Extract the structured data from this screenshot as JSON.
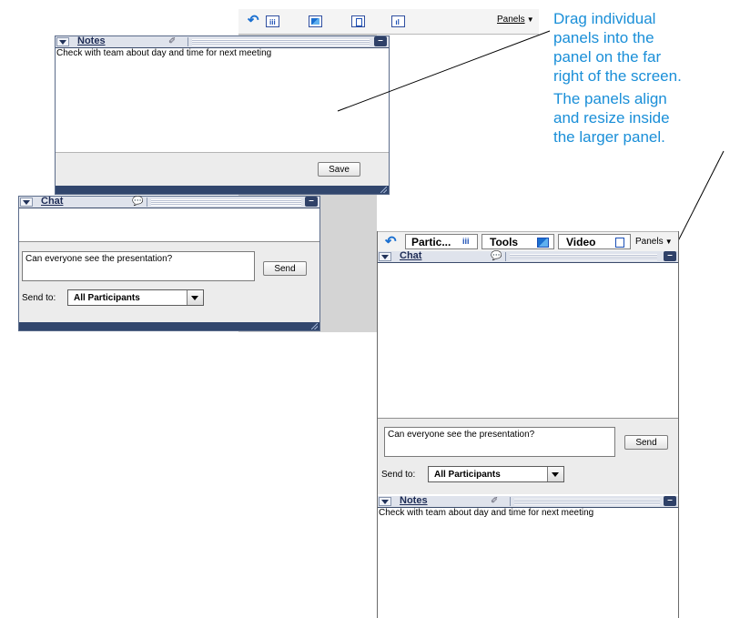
{
  "toolbar_top": {
    "panels_label": "Panels"
  },
  "notes_panel": {
    "title": "Notes",
    "content": "Check with team about day and time for next meeting",
    "save_label": "Save"
  },
  "chat_panel": {
    "title": "Chat",
    "message_value": "Can everyone see the presentation?",
    "send_label": "Send",
    "send_to_label": "Send to:",
    "send_to_value": "All Participants"
  },
  "callouts": {
    "drag": [
      "Drag individual",
      "panels into the",
      "panel on the far",
      "right of the screen."
    ],
    "align": [
      "The panels align",
      "and resize inside",
      "the larger panel."
    ]
  },
  "docked": {
    "tabs": [
      {
        "label": "Partic...",
        "icon": "participants-icon"
      },
      {
        "label": "Tools",
        "icon": "tools-icon"
      },
      {
        "label": "Video",
        "icon": "video-icon"
      }
    ],
    "panels_label": "Panels",
    "chat": {
      "title": "Chat",
      "message_value": "Can everyone see the presentation?",
      "send_label": "Send",
      "send_to_label": "Send to:",
      "send_to_value": "All Participants"
    },
    "notes": {
      "title": "Notes",
      "content": "Check with team about day and time for next meeting"
    }
  },
  "colors": {
    "accent": "#1a8fd8",
    "panel_bar": "#31466d",
    "gray_bg": "#d4d4d4"
  }
}
